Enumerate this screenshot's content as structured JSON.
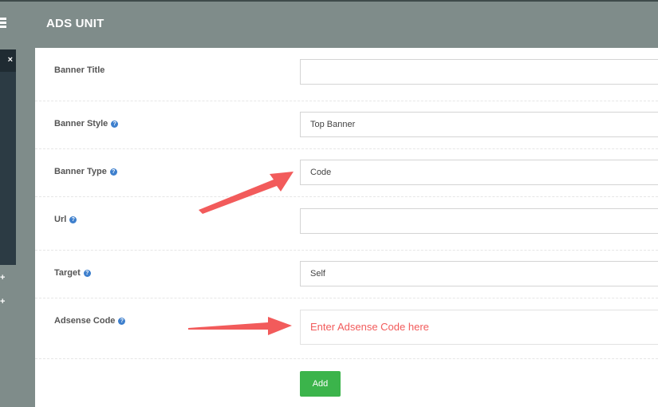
{
  "header": {
    "title": "ADS UNIT"
  },
  "sidebar": {
    "close_label": "×",
    "plus_1": "+",
    "plus_2": "+"
  },
  "form": {
    "fields": [
      {
        "label": "Banner Title",
        "value": ""
      },
      {
        "label": "Banner Style",
        "value": "Top Banner"
      },
      {
        "label": "Banner Type",
        "value": "Code"
      },
      {
        "label": "Url",
        "value": ""
      },
      {
        "label": "Target",
        "value": "Self"
      },
      {
        "label": "Adsense Code",
        "value": "Enter Adsense Code here"
      }
    ],
    "help_glyph": "?",
    "add_label": "Add"
  },
  "colors": {
    "header": "#7f8c8a",
    "sidebar": "#2c3b44",
    "add_button": "#3bb44b",
    "annotation": "#f25b5b"
  }
}
